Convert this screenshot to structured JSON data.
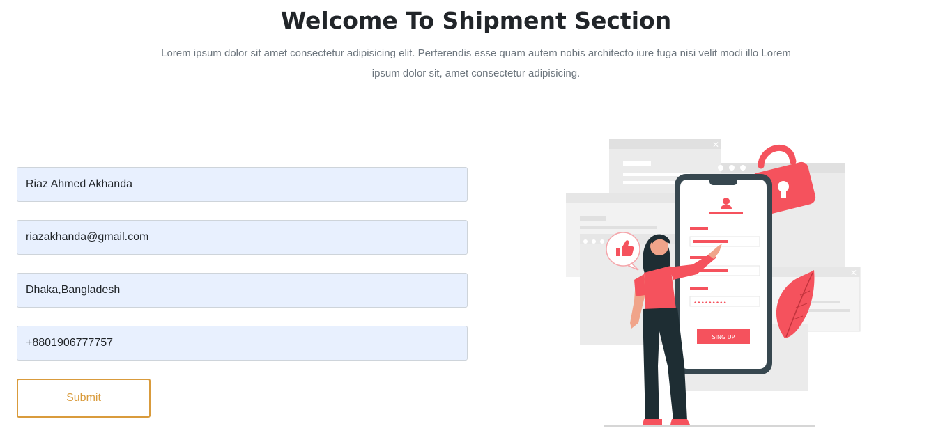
{
  "header": {
    "title": "Welcome To Shipment Section",
    "subtitle": "Lorem ipsum dolor sit amet consectetur adipisicing elit. Perferendis esse quam autem nobis architecto iure fuga nisi velit modi illo Lorem ipsum dolor sit, amet consectetur adipisicing."
  },
  "form": {
    "name_value": "Riaz Ahmed Akhanda",
    "email_value": "riazakhanda@gmail.com",
    "address_value": "Dhaka,Bangladesh",
    "phone_value": "+8801906777757",
    "submit_label": "Submit"
  },
  "illustration": {
    "signup_label": "SING UP",
    "password_mask": "•••••••••",
    "icons": [
      "lock-icon",
      "thumbs-up-icon",
      "user-icon",
      "leaf-icon"
    ],
    "colors": {
      "accent": "#f5525d",
      "phone_frame": "#37474f",
      "figure_dark": "#1e2d33",
      "panel_gray": "#ebebeb"
    }
  }
}
